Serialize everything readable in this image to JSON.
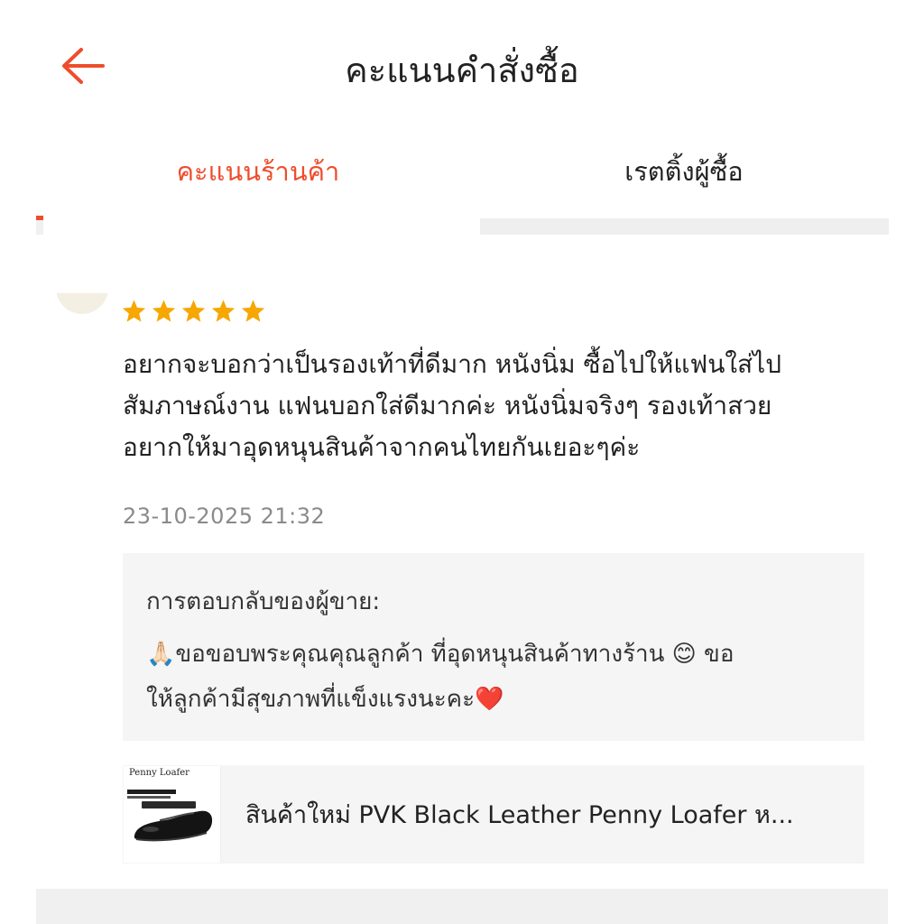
{
  "header": {
    "title": "คะแนนคำสั่งซื้อ",
    "back_icon": "arrow-left-icon",
    "accent_color": "#ee4d2d"
  },
  "tabs": [
    {
      "label": "คะแนนร้านค้า",
      "active": true
    },
    {
      "label": "เรตติ้งผู้ซื้อ",
      "active": false
    }
  ],
  "review": {
    "rating": 5,
    "max_rating": 5,
    "star_color": "#f6a700",
    "text": "อยากจะบอกว่าเป็นรองเท้าที่ดีมาก หนังนิ่ม ซื้อไปให้แฟนใส่ไป\nสัมภาษณ์งาน แฟนบอกใส่ดีมากค่ะ หนังนิ่มจริงๆ รองเท้าสวย\nอยากให้มาอุดหนุนสินค้าจากคนไทยกันเยอะๆค่ะ",
    "date": "23-10-2025 21:32"
  },
  "seller_reply": {
    "title": "การตอบกลับของผู้ขาย:",
    "text": "🙏🏻ขอขอบพระคุณคุณลูกค้า ที่อุดหนุนสินค้าทางร้าน 😊 ขอ\nให้ลูกค้ามีสุขภาพที่แข็งแรงนะคะ❤️"
  },
  "product": {
    "thumbnail_caption": "Penny Loafer",
    "name": "สินค้าใหม่ PVK Black Leather Penny Loafer ห..."
  }
}
